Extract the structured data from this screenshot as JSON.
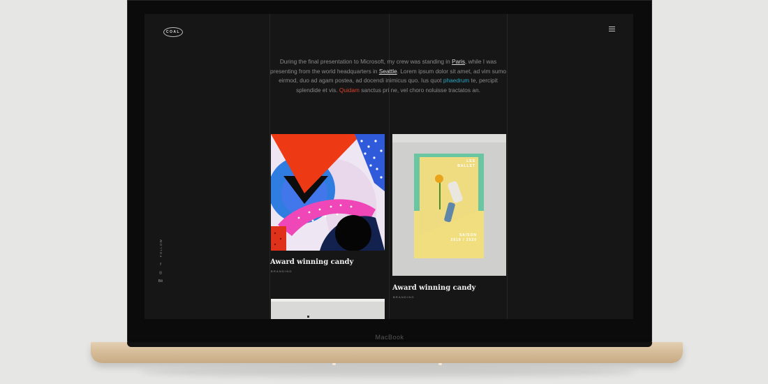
{
  "brand": {
    "logo_text": "COAL"
  },
  "device": {
    "label": "MacBook"
  },
  "intro": {
    "t1": "During the final presentation to Microsoft, my crew was standing in ",
    "link1": "Paris",
    "t2": ", while I was presenting from the world headquarters in ",
    "link2": "Seattle",
    "t3": ". Lorem ipsum dolor sit amet, ad vim sumo eirmod, duo ad agam postea, ad docendi inimicus quo. Ius quot ",
    "link3": "phaedrum",
    "t4": " te, percipit splendide et vis. ",
    "link4": "Quidam",
    "t5": " sanctus pri ne, vel choro noluisse tractatos an."
  },
  "follow": {
    "label": "FOLLOW",
    "icons": [
      {
        "name": "facebook-icon",
        "glyph": "f"
      },
      {
        "name": "instagram-icon",
        "glyph": "◎"
      },
      {
        "name": "behance-icon",
        "glyph": "Bē"
      }
    ]
  },
  "portfolio": [
    {
      "title": "Award winning candy",
      "category": "BRANDING"
    },
    {
      "title": "Award winning candy",
      "category": "BRANDING"
    }
  ],
  "poster": {
    "line1": "LES",
    "line2": "BALLET",
    "line3": "SAISON",
    "line4": "2019 / 2020"
  },
  "colors": {
    "background": "#161616",
    "text": "#8a8a8a",
    "link_teal": "#26a7c4",
    "link_red": "#d8432d"
  }
}
